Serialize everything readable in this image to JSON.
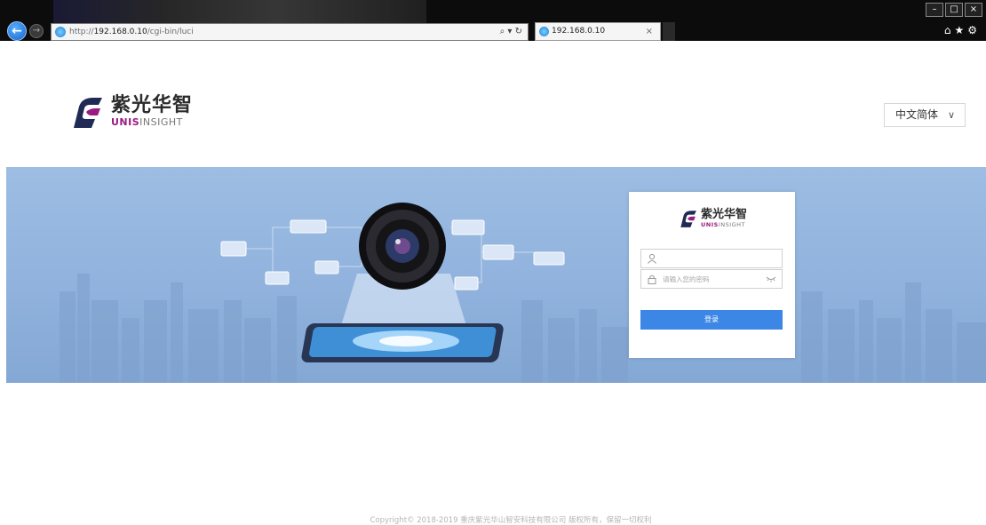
{
  "browser": {
    "url_prefix": "http://",
    "url_host": "192.168.0.10",
    "url_path": "/cgi-bin/luci",
    "address_tools": "⌕ ▾ ↻",
    "tab_title": "192.168.0.10",
    "tab_close": "×",
    "window_controls": [
      "–",
      "□",
      "×"
    ],
    "toolbar_icons": "⌂★⚙",
    "back_label": "←",
    "forward_label": "→"
  },
  "brand": {
    "name_cn": "紫光华智",
    "name_en_bold": "UNIS",
    "name_en_rest": "INSIGHT",
    "accent": "#9a1b82",
    "mark_dark": "#202a55"
  },
  "language": {
    "selected": "中文简体",
    "chevron": "∨"
  },
  "login": {
    "username_placeholder": "",
    "password_placeholder": "请输入您的密码",
    "button_label": "登录",
    "button_color": "#3c86e6"
  },
  "footer": {
    "copyright": "Copyright© 2018-2019 重庆紫光华山智安科技有限公司 版权所有，保留一切权利"
  }
}
